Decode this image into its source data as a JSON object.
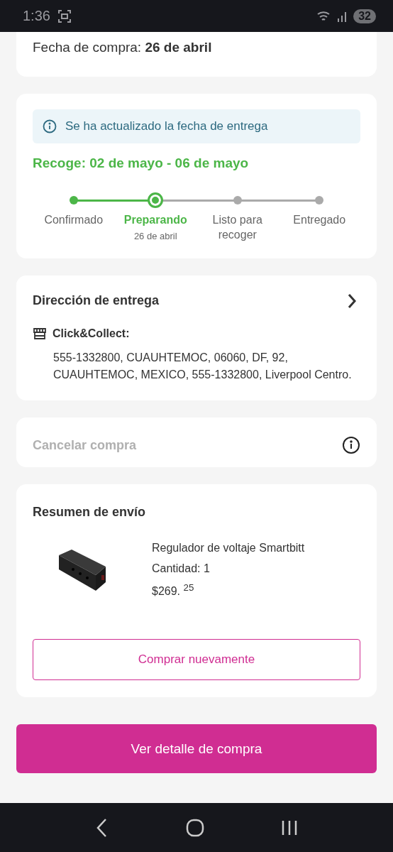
{
  "status_bar": {
    "time": "1:36",
    "battery": "32"
  },
  "purchase": {
    "date_text": "Fecha de compra: **26 de abril**"
  },
  "delivery": {
    "notice": "Se ha actualizado la fecha de entrega",
    "pickup": "Recoge: 02 de mayo - 06 de mayo",
    "steps": [
      {
        "label": "Confirmado",
        "completed": true,
        "selected": false
      },
      {
        "label": "Preparando",
        "completed": true,
        "selected": true,
        "date": "26 de abril"
      },
      {
        "label": "Listo para recoger",
        "completed": false,
        "selected": false
      },
      {
        "label": "Entregado",
        "completed": false,
        "selected": false
      }
    ]
  },
  "address": {
    "title": "Dirección de entrega",
    "method": "Click&Collect:",
    "text": "555-1332800, CUAUHTEMOC, 06060, DF, 92, CUAUHTEMOC, MEXICO, 555-1332800, Liverpool Centro."
  },
  "cancel": {
    "label": "Cancelar compra",
    "disabled": true
  },
  "summary": {
    "title": "Resumen de envío",
    "product": {
      "name": "Regulador de voltaje Smartbitt",
      "quantity": "Cantidad: 1",
      "price": "$269. $^{25}$"
    },
    "rebuy_button": "Comprar nuevamente"
  },
  "detail_button": "Ver detalle de compra"
}
